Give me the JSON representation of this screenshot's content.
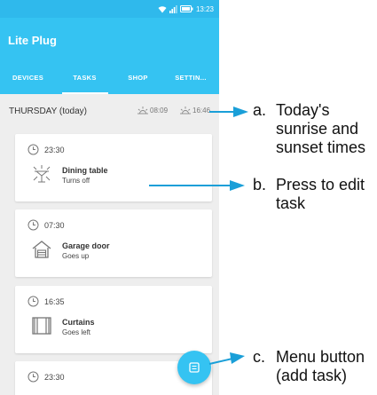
{
  "statusbar": {
    "time": "13:23"
  },
  "app": {
    "title": "Lite Plug"
  },
  "tabs": [
    {
      "label": "DEVICES",
      "active": false
    },
    {
      "label": "TASKS",
      "active": true
    },
    {
      "label": "SHOP",
      "active": false
    },
    {
      "label": "SETTIN...",
      "active": false
    }
  ],
  "day": {
    "label": "THURSDAY (today)",
    "sunrise": "08:09",
    "sunset": "16:46"
  },
  "tasks": [
    {
      "time": "23:30",
      "device": "Dining table",
      "action": "Turns off",
      "icon": "lamp-icon"
    },
    {
      "time": "07:30",
      "device": "Garage door",
      "action": "Goes up",
      "icon": "garage-icon"
    },
    {
      "time": "16:35",
      "device": "Curtains",
      "action": "Goes left",
      "icon": "curtains-icon"
    },
    {
      "time": "23:30",
      "device": "",
      "action": "",
      "icon": ""
    }
  ],
  "annotations": [
    {
      "letter": "a.",
      "text": [
        "Today's",
        "sunrise and",
        "sunset times"
      ]
    },
    {
      "letter": "b.",
      "text": [
        "Press to edit",
        "task"
      ]
    },
    {
      "letter": "c.",
      "text": [
        "Menu button",
        "(add task)"
      ]
    }
  ],
  "colors": {
    "accent": "#35c3f2",
    "arrow": "#1a9fd8"
  }
}
